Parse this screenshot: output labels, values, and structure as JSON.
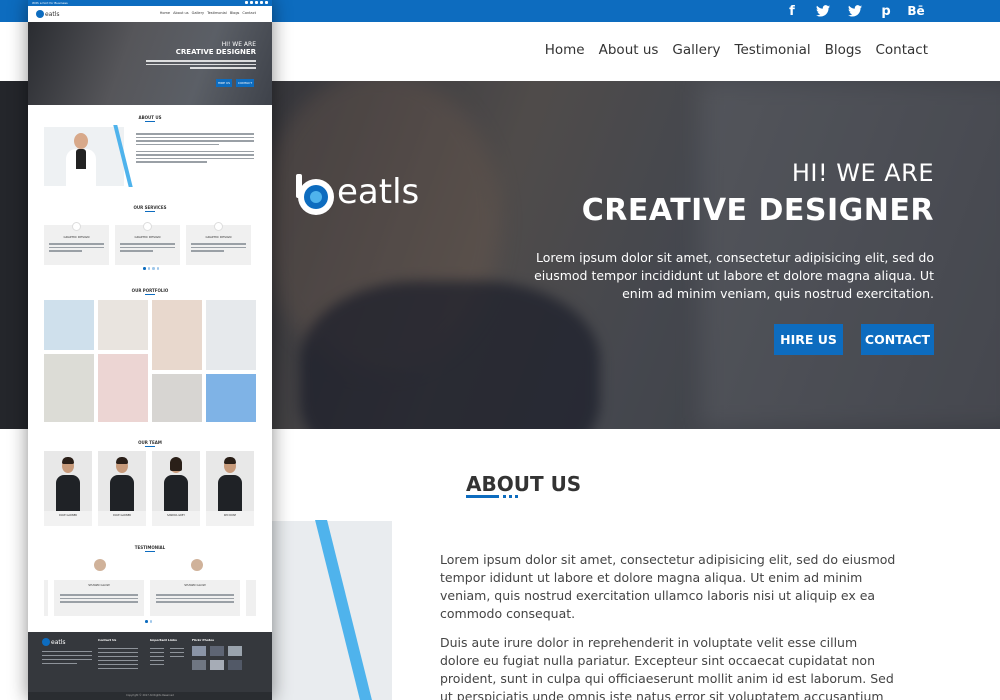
{
  "colors": {
    "accent": "#0d6cbf",
    "stripe": "#4fb3ec",
    "dark": "#35383d"
  },
  "topbar": {
    "social_icons": [
      "facebook-icon",
      "twitter-icon",
      "twitter-icon",
      "pinterest-icon",
      "behance-icon"
    ],
    "social_glyphs": [
      "f",
      "t",
      "t",
      "p",
      "Bē"
    ]
  },
  "nav": {
    "logo_text": "eatls",
    "items": [
      "Home",
      "About us",
      "Gallery",
      "Testimonial",
      "Blogs",
      "Contact"
    ]
  },
  "hero": {
    "subtitle": "HI! WE ARE",
    "title": "CREATIVE DESIGNER",
    "text": "Lorem ipsum dolor sit amet, consectetur adipisicing elit, sed do eiusmod tempor incididunt ut labore et dolore magna aliqua. Ut enim ad minim veniam, quis nostrud exercitation.",
    "btn_hire": "HIRE US",
    "btn_contact": "CONTACT"
  },
  "about": {
    "title": "ABOUT US",
    "p1": "Lorem ipsum dolor sit amet, consectetur adipisicing elit, sed do eiusmod tempor ididunt ut labore et dolore magna aliqua. Ut enim ad minim veniam, quis nostrud exercitation ullamco laboris nisi ut aliquip ex ea commodo consequat.",
    "p2": "Duis aute irure dolor in reprehenderit in voluptate velit esse cillum dolore eu fugiat nulla pariatur. Excepteur sint occaecat cupidatat non proident, sunt in culpa qui officiaeserunt mollit anim id est laborum. Sed ut perspiciatis unde omnis iste natus error sit voluptatem accusantium doloremque laudantium."
  },
  "mini": {
    "topbar_text": "With a hint for Business",
    "logo_text": "eatls",
    "nav_items": [
      "Home",
      "About us",
      "Gallery",
      "Testimonial",
      "Blogs",
      "Contact"
    ],
    "hero_subtitle": "HI! WE ARE",
    "hero_title": "CREATIVE DESIGNER",
    "btn_hire": "HIRE US",
    "btn_contact": "CONTACT",
    "about_title": "ABOUT US",
    "services_title": "OUR SERVICES",
    "service_names": [
      "GRAPHIC DESIGN",
      "GRAPHIC DESIGN",
      "GRAPHIC DESIGN"
    ],
    "portfolio_title": "OUR PORTFOLIO",
    "team_title": "OUR TEAM",
    "team": [
      {
        "name": "DAVE GARNER",
        "role": "Web Designer"
      },
      {
        "name": "DAVE GARNER",
        "role": "Web Designer"
      },
      {
        "name": "SANDRA GREY",
        "role": "Web Designer"
      },
      {
        "name": "KIM ROSE",
        "role": "Web Designer"
      }
    ],
    "testimonial_title": "TESTIMONIAL",
    "testimonial_names": [
      "SHAWN GLOW",
      "SHAWN GLOW"
    ],
    "footer_cols": [
      "Contact Us",
      "Important Links",
      "Flickr Photos"
    ],
    "footer_links": [
      "Home",
      "About Us",
      "Portfolio",
      "Our Team",
      "Blog",
      "Pricing",
      "Blog",
      "Feedback"
    ],
    "copyright": "Copyright © 2017 All Rights Reserved"
  }
}
